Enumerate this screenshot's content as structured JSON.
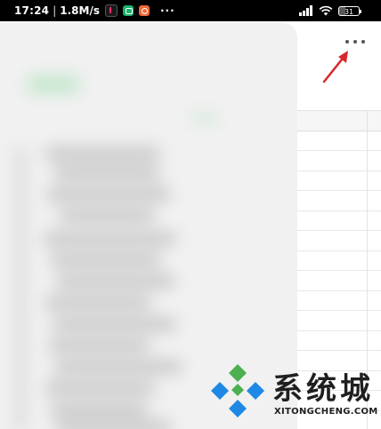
{
  "status_bar": {
    "time": "17:24",
    "separator": "|",
    "net_speed": "1.8M/s",
    "notification_icons": [
      "tiktok-icon",
      "green-app-icon",
      "orange-app-icon"
    ],
    "more_indicator": "···",
    "battery_level": "31",
    "signal_icon": "signal-icon",
    "wifi_icon": "wifi-icon"
  },
  "toolbar": {
    "more_button_icon": "more-horizontal-icon",
    "annotation_icon": "red-arrow-icon"
  },
  "watermark": {
    "title": "系统城",
    "url": "XITONGCHENG.COM"
  },
  "colors": {
    "status_bar_bg": "#000000",
    "annotation_arrow": "#d9262a",
    "logo_green": "#4caf50",
    "logo_blue": "#1e88e5",
    "sheet_grid": "#e8e8e8"
  }
}
